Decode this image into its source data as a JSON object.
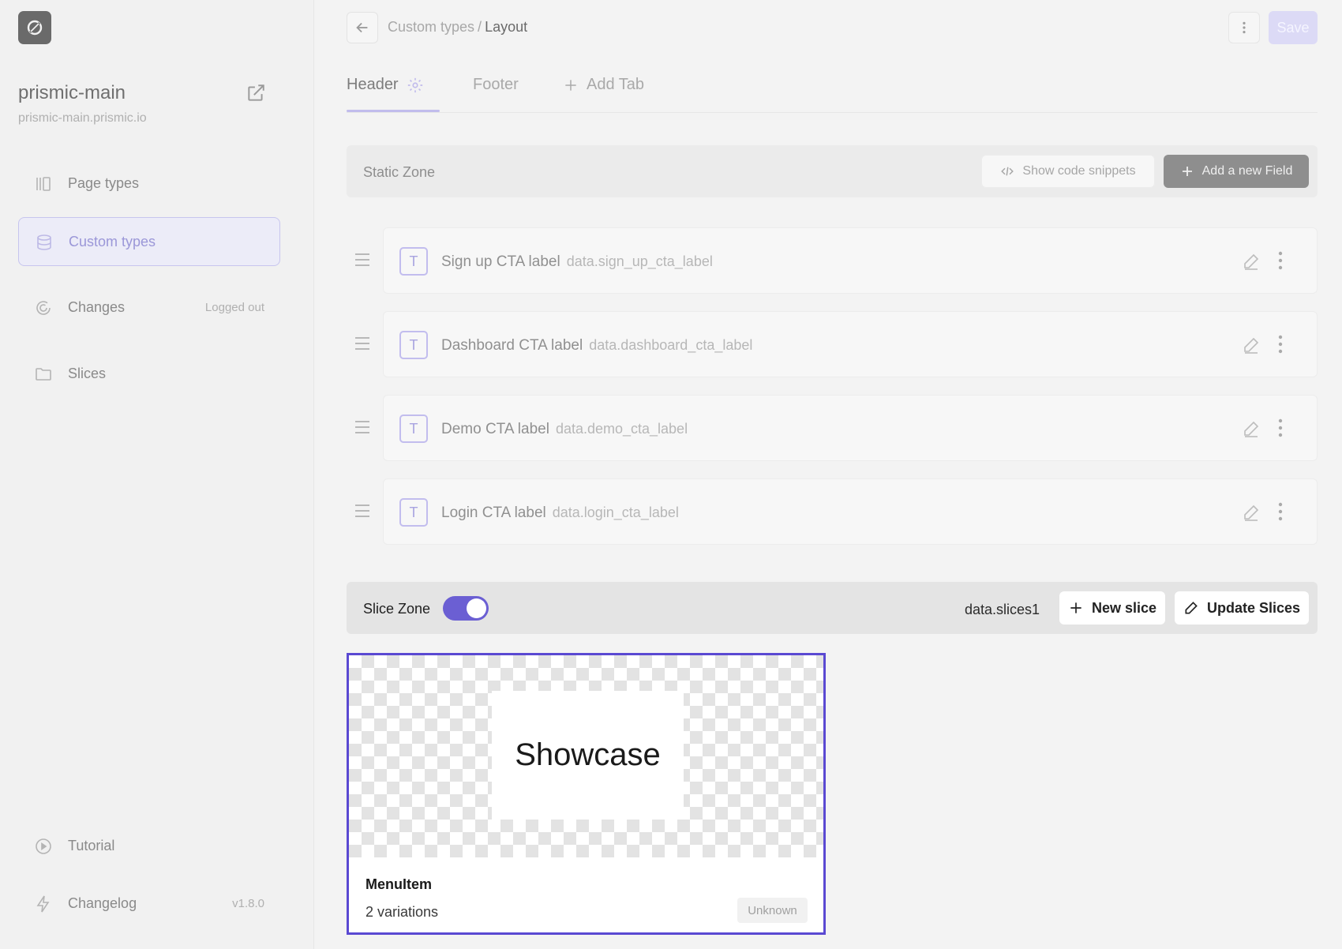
{
  "sidebar": {
    "repo_name": "prismic-main",
    "repo_url": "prismic-main.prismic.io",
    "nav": [
      {
        "label": "Page types",
        "icon": "page-types-icon"
      },
      {
        "label": "Custom types",
        "icon": "database-icon",
        "active": true
      },
      {
        "label": "Changes",
        "icon": "changes-icon",
        "aside": "Logged out"
      },
      {
        "label": "Slices",
        "icon": "folder-icon"
      }
    ],
    "footer_nav": [
      {
        "label": "Tutorial",
        "icon": "play-circle-icon"
      },
      {
        "label": "Changelog",
        "icon": "lightning-icon",
        "aside": "v1.8.0"
      }
    ]
  },
  "header": {
    "breadcrumb_parent": "Custom types",
    "breadcrumb_sep": "/",
    "breadcrumb_current": "Layout",
    "save_label": "Save"
  },
  "tabs": [
    {
      "label": "Header",
      "active": true
    },
    {
      "label": "Footer"
    },
    {
      "label": "Add Tab"
    }
  ],
  "static_zone": {
    "title": "Static Zone",
    "snippets_label": "Show code snippets",
    "add_field_label": "Add a new Field",
    "fields": [
      {
        "type_glyph": "T",
        "name": "Sign up CTA label",
        "key": "data.sign_up_cta_label"
      },
      {
        "type_glyph": "T",
        "name": "Dashboard CTA label",
        "key": "data.dashboard_cta_label"
      },
      {
        "type_glyph": "T",
        "name": "Demo CTA label",
        "key": "data.demo_cta_label"
      },
      {
        "type_glyph": "T",
        "name": "Login CTA label",
        "key": "data.login_cta_label"
      }
    ]
  },
  "slice_zone": {
    "title": "Slice Zone",
    "enabled": true,
    "key": "data.slices1",
    "new_slice_label": "New slice",
    "update_slices_label": "Update Slices"
  },
  "slice_card": {
    "preview_text": "Showcase",
    "name": "MenuItem",
    "variations": "2 variations",
    "status": "Unknown"
  },
  "colors": {
    "accent": "#5a49d2",
    "toggle_on": "#6b5fd3",
    "sidebar_active_bg": "#ececf8"
  }
}
